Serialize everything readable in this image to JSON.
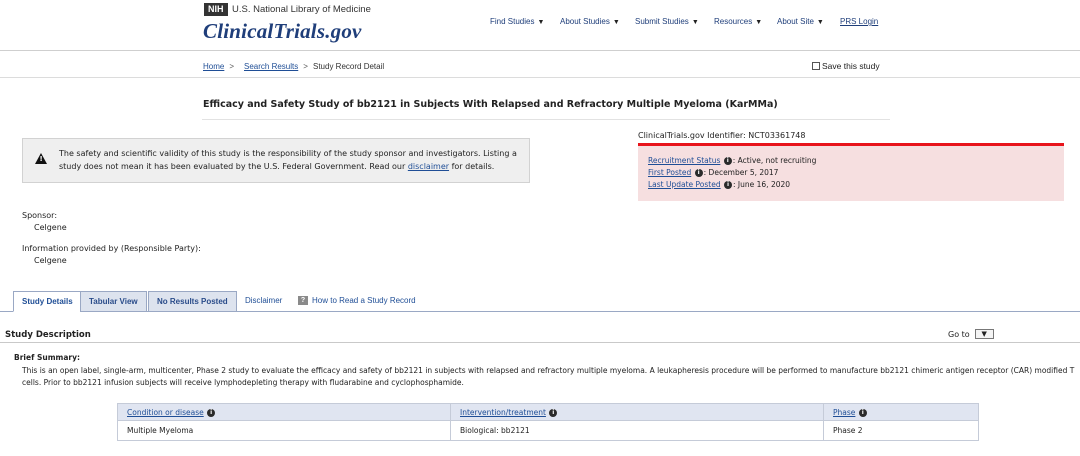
{
  "header": {
    "nih_badge": "NIH",
    "nih_name": "U.S. National Library of Medicine",
    "brand": "ClinicalTrials.gov",
    "nav": [
      "Find Studies",
      "About Studies",
      "Submit Studies",
      "Resources",
      "About Site"
    ],
    "prs_login": "PRS Login"
  },
  "breadcrumb": {
    "home": "Home",
    "search_results": "Search Results",
    "sep": ">",
    "current": "Study Record Detail"
  },
  "save_study": "Save this study",
  "study_title": "Efficacy and Safety Study of bb2121 in Subjects With Relapsed and Refractory Multiple Myeloma (KarMMa)",
  "warning": {
    "text_before": "The safety and scientific validity of this study is the responsibility of the study sponsor and investigators. Listing a study does not mean it has been evaluated by the U.S. Federal Government. Read our ",
    "link": "disclaimer",
    "text_after": " for details."
  },
  "identifier": {
    "label": "ClinicalTrials.gov Identifier:",
    "value": "NCT03361748"
  },
  "status": {
    "recruitment_label": "Recruitment Status",
    "recruitment_value": ": Active, not recruiting",
    "first_posted_label": "First Posted",
    "first_posted_value": ": December 5, 2017",
    "last_update_label": "Last Update Posted",
    "last_update_value": ": June 16, 2020"
  },
  "sponsor": {
    "label": "Sponsor:",
    "value": "Celgene",
    "provided_label": "Information provided by (Responsible Party):",
    "provided_value": "Celgene"
  },
  "tabs": {
    "study_details": "Study Details",
    "tabular_view": "Tabular View",
    "no_results": "No Results Posted",
    "disclaimer": "Disclaimer",
    "how_to_read": "How to Read a Study Record",
    "how_icon": "?"
  },
  "description": {
    "heading": "Study Description",
    "goto": "Go to",
    "brief_label": "Brief Summary:",
    "brief_text": "This is an open label, single-arm, multicenter, Phase 2 study to evaluate the efficacy and safety of bb2121 in subjects with relapsed and refractory multiple myeloma. A leukapheresis procedure will be performed to manufacture bb2121 chimeric antigen receptor (CAR) modified T cells. Prior to bb2121 infusion subjects will receive lymphodepleting therapy with fludarabine and cyclophosphamide."
  },
  "conditions_table": {
    "headers": [
      "Condition or disease",
      "Intervention/treatment",
      "Phase"
    ],
    "rows": [
      [
        "Multiple Myeloma",
        "Biological: bb2121",
        "Phase 2"
      ]
    ]
  },
  "icons": {
    "info": "info-circle-icon",
    "warning": "warning-triangle-icon",
    "caret": "caret-down-icon"
  },
  "colors": {
    "brand": "#1f3e7a",
    "link": "#1f4e96",
    "status_bg": "#f6dfe0",
    "status_bar": "#e8141b"
  }
}
